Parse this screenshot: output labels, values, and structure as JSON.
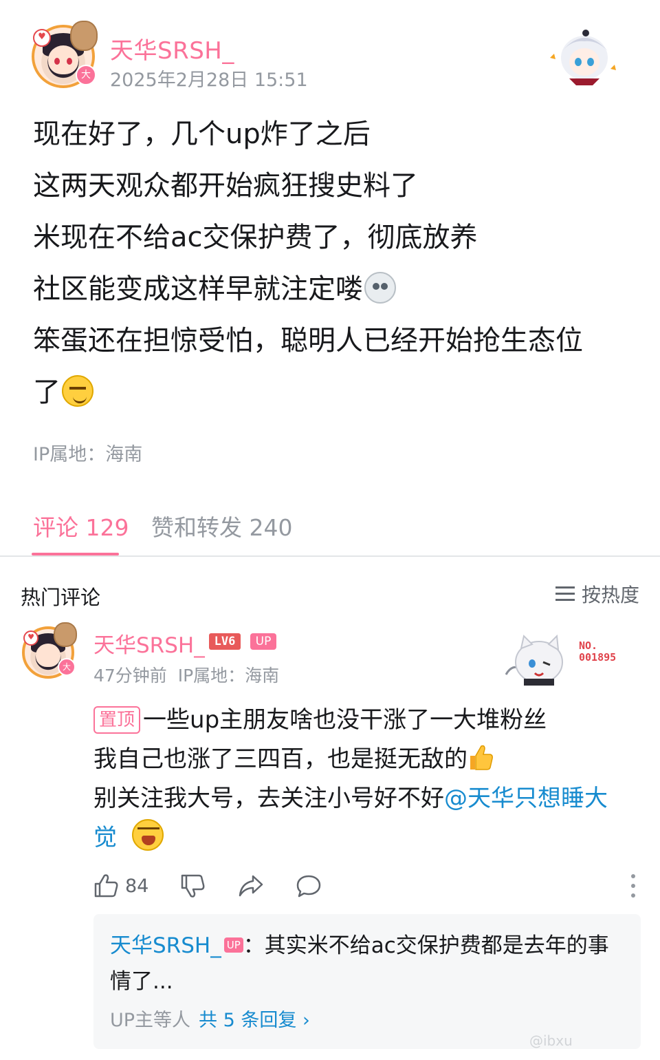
{
  "post": {
    "author": "天华SRSH_",
    "timestamp": "2025年2月28日 15:51",
    "avatar_badge": "大",
    "lines": [
      "现在好了，几个up炸了之后",
      "这两天观众都开始疯狂搜史料了",
      "米现在不给ac交保护费了，彻底放养",
      "社区能变成这样早就注定喽",
      "笨蛋还在担惊受怕，聪明人已经开始抢生态位",
      "了"
    ],
    "ip_location": "IP属地：海南"
  },
  "tabs": {
    "comments": "评论 129",
    "likes_reposts": "赞和转发 240"
  },
  "hot_comments": {
    "title": "热门评论",
    "sort_label": "按热度"
  },
  "comment": {
    "author": "天华SRSH_",
    "level_badge": "LV6",
    "up_badge": "UP",
    "meta": "47分钟前  IP属地：海南",
    "decor_number": "NO.\n001895",
    "pin_tag": "置顶",
    "line1": "一些up主朋友啥也没干涨了一大堆粉丝",
    "line2": "我自己也涨了三四百，也是挺无敌的",
    "line3_text": "别关注我大号，去关注小号好不好",
    "mention_part1": "@天华只想睡大",
    "mention_part2": "觉",
    "like_count": "84"
  },
  "reply": {
    "author": "天华SRSH_",
    "up_badge": "UP",
    "text": "：其实米不给ac交保护费都是去年的事情了...",
    "footer_who": "UP主等人",
    "footer_count": "共 5 条回复 ›"
  },
  "watermark": "@ibxu"
}
